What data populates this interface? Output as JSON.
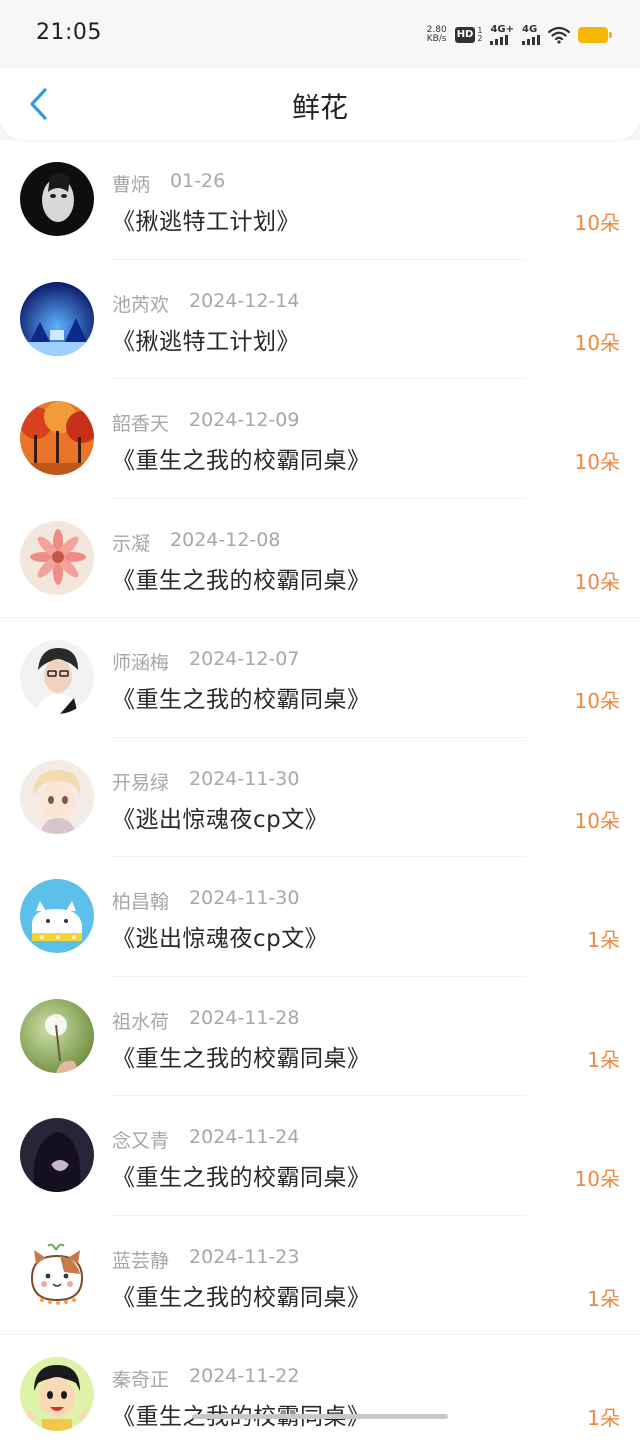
{
  "status_bar": {
    "time": "21:05",
    "net_speed_value": "2.80",
    "net_speed_unit": "KB/s",
    "hd_label": "HD",
    "hd_sub_top": "1",
    "hd_sub_bottom": "2",
    "signal1_label": "4G+",
    "signal2_label": "4G",
    "battery_color": "#f5b800"
  },
  "nav": {
    "title": "鲜花",
    "back_icon": "chevron-left-icon",
    "accent": "#2f9bd8"
  },
  "records": [
    {
      "user": "曹炳",
      "date": "01-26",
      "book": "《揪逃特工计划》",
      "flowers": "10朵"
    },
    {
      "user": "池芮欢",
      "date": "2024-12-14",
      "book": "《揪逃特工计划》",
      "flowers": "10朵"
    },
    {
      "user": "韶香天",
      "date": "2024-12-09",
      "book": "《重生之我的校霸同桌》",
      "flowers": "10朵"
    },
    {
      "user": "示凝",
      "date": "2024-12-08",
      "book": "《重生之我的校霸同桌》",
      "flowers": "10朵"
    },
    {
      "user": "师涵梅",
      "date": "2024-12-07",
      "book": "《重生之我的校霸同桌》",
      "flowers": "10朵"
    },
    {
      "user": "开易绿",
      "date": "2024-11-30",
      "book": "《逃出惊魂夜cp文》",
      "flowers": "10朵"
    },
    {
      "user": "柏昌翰",
      "date": "2024-11-30",
      "book": "《逃出惊魂夜cp文》",
      "flowers": "1朵"
    },
    {
      "user": "祖水荷",
      "date": "2024-11-28",
      "book": "《重生之我的校霸同桌》",
      "flowers": "1朵"
    },
    {
      "user": "念又青",
      "date": "2024-11-24",
      "book": "《重生之我的校霸同桌》",
      "flowers": "10朵"
    },
    {
      "user": "蓝芸静",
      "date": "2024-11-23",
      "book": "《重生之我的校霸同桌》",
      "flowers": "1朵"
    },
    {
      "user": "秦奇正",
      "date": "2024-11-22",
      "book": "《重生之我的校霸同桌》",
      "flowers": "1朵"
    }
  ],
  "colors": {
    "flower_count": "#f0883e",
    "meta_text": "#a7a7a7",
    "title_text": "#2a2a2a"
  }
}
